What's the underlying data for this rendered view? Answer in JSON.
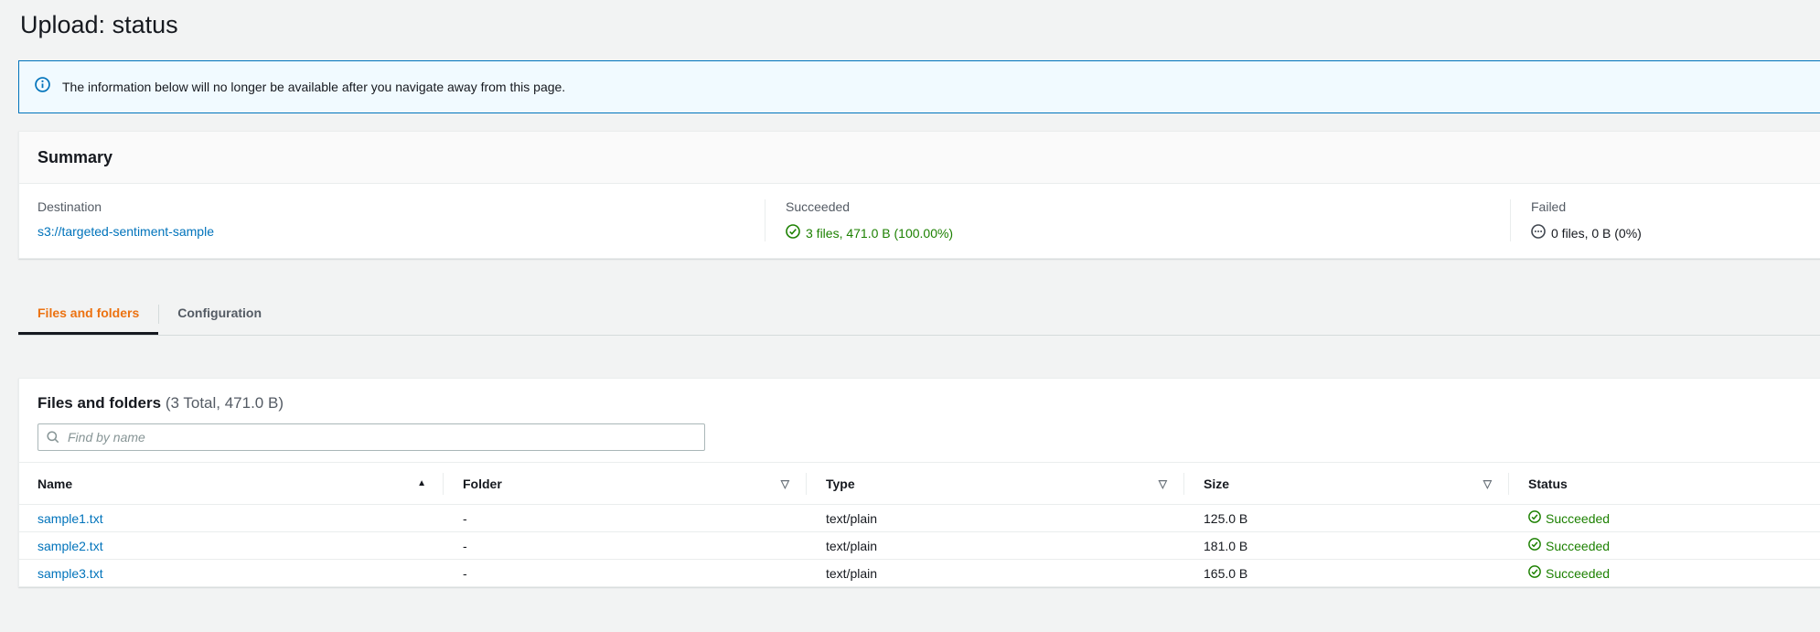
{
  "page": {
    "title": "Upload: status"
  },
  "banner": {
    "icon": "info-icon",
    "text": "The information below will no longer be available after you navigate away from this page."
  },
  "summary": {
    "title": "Summary",
    "destination": {
      "label": "Destination",
      "value": "s3://targeted-sentiment-sample"
    },
    "succeeded": {
      "label": "Succeeded",
      "value": "3 files, 471.0 B (100.00%)",
      "icon": "check-circle-icon"
    },
    "failed": {
      "label": "Failed",
      "value": "0 files, 0 B (0%)",
      "icon": "ellipsis-circle-icon"
    }
  },
  "tabs": [
    {
      "label": "Files and folders",
      "active": true
    },
    {
      "label": "Configuration",
      "active": false
    }
  ],
  "files_panel": {
    "title": "Files and folders",
    "count_summary": "(3 Total, 471.0 B)",
    "search": {
      "placeholder": "Find by name",
      "value": ""
    },
    "table": {
      "columns": [
        "Name",
        "Folder",
        "Type",
        "Size",
        "Status"
      ],
      "rows": [
        {
          "name": "sample1.txt",
          "folder": "-",
          "type": "text/plain",
          "size": "125.0 B",
          "status": "Succeeded"
        },
        {
          "name": "sample2.txt",
          "folder": "-",
          "type": "text/plain",
          "size": "181.0 B",
          "status": "Succeeded"
        },
        {
          "name": "sample3.txt",
          "folder": "-",
          "type": "text/plain",
          "size": "165.0 B",
          "status": "Succeeded"
        }
      ]
    }
  },
  "colors": {
    "accent_blue": "#0073bb",
    "success_green": "#1d8102",
    "active_tab_orange": "#ec7211",
    "banner_bg": "#f1faff",
    "page_bg": "#f2f3f3",
    "border": "#eaeded"
  }
}
